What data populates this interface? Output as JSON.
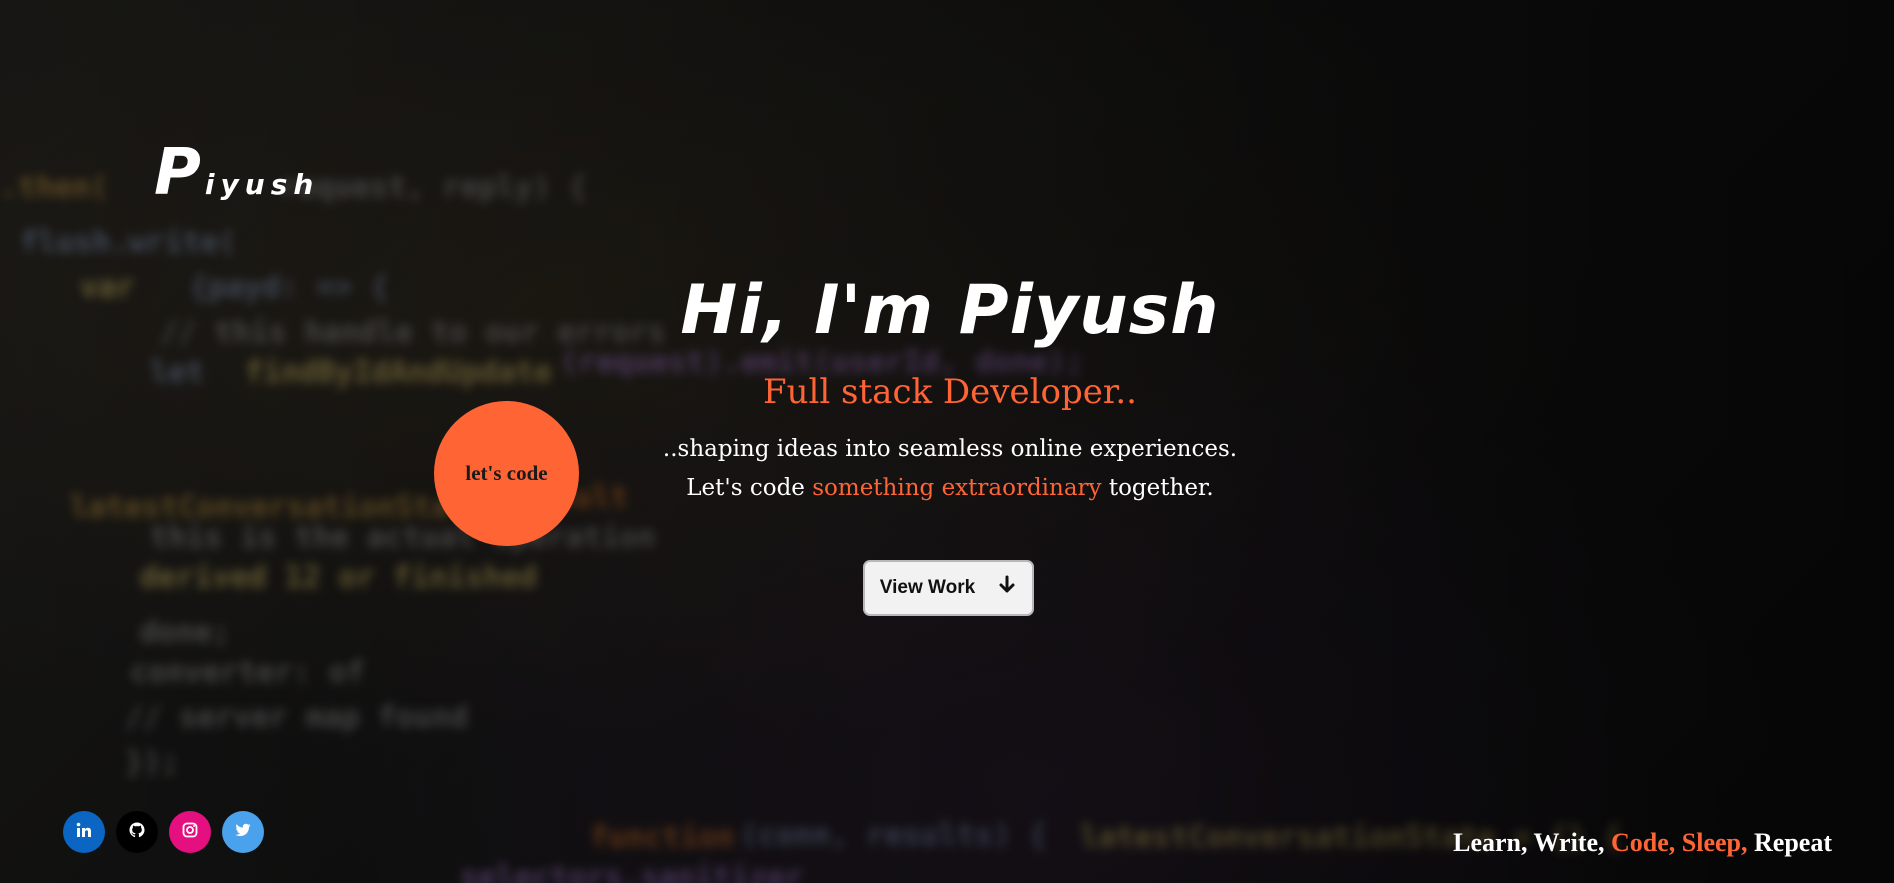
{
  "logo": {
    "initial": "P",
    "rest": "iyush"
  },
  "hero": {
    "headline": "Hi, I'm Piyush",
    "subtitle": "Full stack Developer..",
    "desc_line1": "..shaping ideas into seamless online experiences.",
    "desc_line2_pre": "Let's code ",
    "desc_line2_accent": "something extraordinary",
    "desc_line2_post": " together."
  },
  "cta": {
    "label": "View Work",
    "icon": "arrow-down-icon"
  },
  "badge": {
    "label": "let's code"
  },
  "socials": [
    {
      "name": "linkedin",
      "icon": "linkedin-icon",
      "color": "#0a66c2"
    },
    {
      "name": "github",
      "icon": "github-icon",
      "color": "#000000"
    },
    {
      "name": "instagram",
      "icon": "instagram-icon",
      "color": "#e4107f"
    },
    {
      "name": "twitter",
      "icon": "twitter-icon",
      "color": "#4aa1ec"
    }
  ],
  "tagline": {
    "part1": "Learn, Write, ",
    "part2": "Code, Sleep,",
    "part3": " Repeat"
  },
  "colors": {
    "accent": "#ff6435",
    "text": "#ffffff",
    "button_bg": "#f2f2f2"
  }
}
